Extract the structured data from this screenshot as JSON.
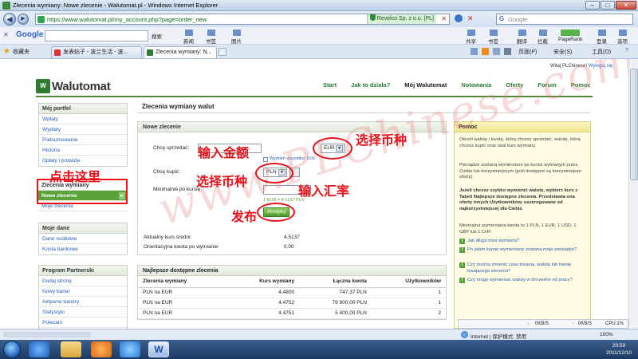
{
  "window": {
    "title": "Zlecenia wymiany: Nowe zlecenie - Walutomat.pl - Windows Internet Explorer"
  },
  "address_bar": {
    "url": "https://www.walutomat.pl/my_account.php?page=order_new",
    "cert_label": "Revelco Sp. z o.o. [PL]",
    "search_placeholder": "Google"
  },
  "google_toolbar": {
    "logo": "Google",
    "search_btn": "搜索",
    "items": [
      "新闻",
      "书签",
      "图片",
      "共享",
      "书签",
      "翻译",
      "拦截",
      "PageRank",
      "登录",
      "选项"
    ]
  },
  "tabs_row": {
    "favorites": "收藏夹",
    "tabs": [
      {
        "label": "发表帖子 - 波兰生活 - 波...",
        "active": false
      },
      {
        "label": "Zlecenia wymiany: N...",
        "active": true
      }
    ],
    "commands": [
      "页面(P)",
      "安全(S)",
      "工具(O)"
    ]
  },
  "site": {
    "login_text": "Witaj PLChinese!",
    "logout_link": "Wyloguj się",
    "logo_mark": "W",
    "logo_word": "Walutomat",
    "nav": [
      "Start",
      "Jak to działa?",
      "Mój Walutomat",
      "Notowania",
      "Oferty",
      "Forum",
      "Pomoc"
    ]
  },
  "sidebar": {
    "sections": [
      {
        "title": "Mój portfel",
        "items": [
          "Wpłaty",
          "Wypłaty",
          "Podsumowanie",
          "Historia",
          "Opłaty i prowizje"
        ]
      },
      {
        "title": "Zlecenia wymiany",
        "items": [
          "Nowe zlecenie",
          "Moje zlecenia"
        ]
      },
      {
        "title": "Moje dane",
        "items": [
          "Dane osobowe",
          "Konta bankowe"
        ]
      },
      {
        "title": "Program Partnerski",
        "items": [
          "Dodaj stronę",
          "Nowy baner",
          "Aktywne banery",
          "Statystyki",
          "Polecani"
        ]
      }
    ]
  },
  "main": {
    "title": "Zlecenia wymiany walut",
    "new_order": {
      "header": "Nowe zlecenie",
      "sell_label": "Chcę sprzedać:",
      "sell_currency": "EUR",
      "sell_all": "Wymień wszystko: 0,00",
      "buy_label": "Chcę kupić:",
      "buy_currency": "PLN",
      "min_rate_label": "Minimalnie po kursie:",
      "rate_hint": "1 EUR = 4.5137 PLN",
      "submit": "Akceptuj",
      "avg_rate_label": "Aktualny kurs średni:",
      "avg_rate_value": "4.5137",
      "approx_label": "Orientacyjna kwota po wymianie:",
      "approx_value": "0.00"
    },
    "best_orders": {
      "header": "Najlepsze dostępne zlecenia",
      "columns": [
        "Zlecenia wymiany",
        "Kurs wymiany",
        "Łączna kwota",
        "Użytkowników"
      ],
      "rows": [
        [
          "PLN na EUR",
          "4.4800",
          "747,37 PLN",
          "1"
        ],
        [
          "PLN na EUR",
          "4.4752",
          "79 900,00 PLN",
          "1"
        ],
        [
          "PLN na EUR",
          "4.4751",
          "5 400,00 PLN",
          "2"
        ]
      ]
    }
  },
  "help": {
    "header": "Pomoc",
    "paragraphs": [
      "Określ walutę i kwotę, którą chcesz sprzedać, walutę, którą chcesz kupić oraz usal kurs wymiany.",
      "Pieniądze zostaną wymienione po kursie wybranym przez Ciebie lub korzystniejszym (jeśli dostępne są korzystniejsze oferty).",
      "Jeżeli chcesz szybko wymienić walutę, wybierz kurs z Tabeli Najlepsze dostępne zlecenia. Przedstawia ona oferty innych Użytkowników, uszeregowane od najkorzystniejszej dla Ciebie.",
      "Minimalna wymieniana kwota to 1 PLN, 1 EUR, 1 USD, 1 GBP lub 1 CHF."
    ],
    "questions": [
      "Jak długo trwa wymiana?",
      "Po jakim kursie wymienione zostaną moje pieniądze?",
      "Czy można zmienić czas trwania, walutę lub kwotę trwającego zlecenia?",
      "Czy mogę wymieniać waluty w dni wolne od pracy?"
    ]
  },
  "annotations": {
    "click_here": "点击这里",
    "enter_amount": "输入金额",
    "choose_currency_1": "选择币种",
    "choose_currency_2": "选择币种",
    "enter_rate": "输入汇率",
    "publish": "发布",
    "watermark": "www.PLChinese.com"
  },
  "status_bar": {
    "zone": "Internet | 保护模式: 禁用",
    "zoom": "100%",
    "down": "0KB/S",
    "up": "0KB/S",
    "cpu": "CPU:1%"
  },
  "taskbar": {
    "time": "20:59",
    "date": "2011/12/10"
  },
  "colors": {
    "brand_green": "#2f7b33",
    "selected_green": "#5aa33b",
    "annotation_red": "#e8121a"
  }
}
